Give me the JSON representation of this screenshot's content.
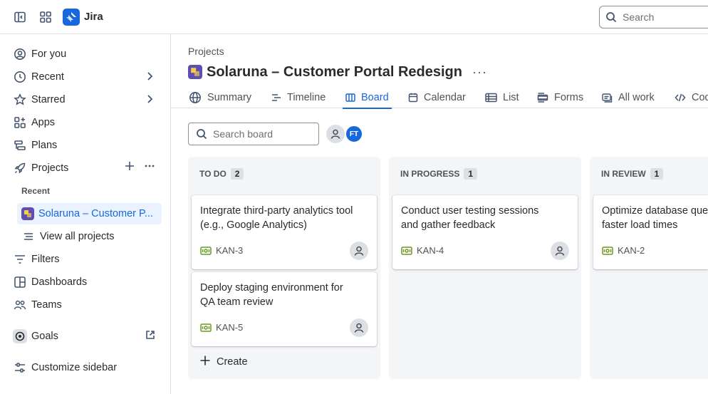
{
  "topbar": {
    "app_name": "Jira",
    "search_placeholder": "Search",
    "icons": [
      "sidebar-toggle-icon",
      "app-switcher-icon",
      "jira-logo",
      "search-icon"
    ]
  },
  "sidebar": {
    "items": [
      {
        "label": "For you",
        "icon": "person-circle-icon"
      },
      {
        "label": "Recent",
        "icon": "clock-icon"
      },
      {
        "label": "Starred",
        "icon": "star-icon"
      },
      {
        "label": "Apps",
        "icon": "apps-icon"
      },
      {
        "label": "Plans",
        "icon": "plans-icon"
      },
      {
        "label": "Projects",
        "icon": "rocket-icon"
      }
    ],
    "recent_label": "Recent",
    "recent_project": "Solaruna – Customer P...",
    "view_all": "View all projects",
    "items2": [
      {
        "label": "Filters",
        "icon": "filter-icon"
      },
      {
        "label": "Dashboards",
        "icon": "dashboard-icon"
      },
      {
        "label": "Teams",
        "icon": "people-icon"
      }
    ],
    "goals": "Goals",
    "customize": "Customize sidebar"
  },
  "header": {
    "breadcrumb": "Projects",
    "title": "Solaruna – Customer Portal Redesign",
    "more": "···"
  },
  "tabs": [
    {
      "label": "Summary",
      "icon": "globe-icon"
    },
    {
      "label": "Timeline",
      "icon": "timeline-icon"
    },
    {
      "label": "Board",
      "icon": "board-icon",
      "active": true
    },
    {
      "label": "Calendar",
      "icon": "calendar-icon"
    },
    {
      "label": "List",
      "icon": "list-icon"
    },
    {
      "label": "Forms",
      "icon": "forms-icon"
    },
    {
      "label": "All work",
      "icon": "all-work-icon"
    },
    {
      "label": "Cod",
      "icon": "code-icon"
    }
  ],
  "board": {
    "search_placeholder": "Search board",
    "avatar_initials": "FT",
    "columns": [
      {
        "name": "TO DO",
        "count": "2",
        "cards": [
          {
            "title": "Integrate third-party analytics tool (e.g., Google Analytics)",
            "key": "KAN-3"
          },
          {
            "title": "Deploy staging environment for QA team review",
            "key": "KAN-5"
          }
        ],
        "create_label": "Create"
      },
      {
        "name": "IN PROGRESS",
        "count": "1",
        "cards": [
          {
            "title": "Conduct user testing sessions and gather feedback",
            "key": "KAN-4"
          }
        ]
      },
      {
        "name": "IN REVIEW",
        "count": "1",
        "cards": [
          {
            "title": "Optimize database queries for faster load times",
            "key": "KAN-2"
          }
        ]
      }
    ]
  },
  "colors": {
    "accent": "#1868db",
    "project_icon": "#5e4db2",
    "story_icon": "#6a9a23"
  }
}
